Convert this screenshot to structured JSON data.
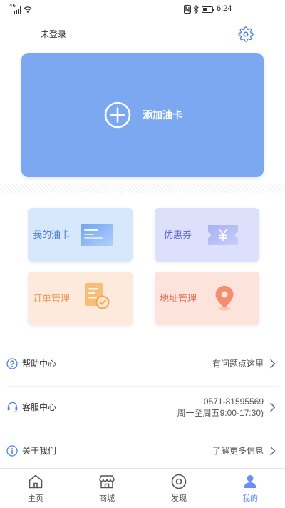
{
  "status_bar": {
    "network": "46",
    "time": "6:24",
    "icons": [
      "signal-icon",
      "wifi-icon",
      "nfc-icon",
      "bluetooth-icon",
      "battery-icon"
    ]
  },
  "header": {
    "login_status": "未登录",
    "settings_icon": "gear-icon"
  },
  "add_card": {
    "label": "添加油卡",
    "icon": "plus-circle-icon",
    "color": "#7BA8F1"
  },
  "features": [
    {
      "label": "我的油卡",
      "icon": "oil-card-icon",
      "bg": "#D7E7FC",
      "text_color": "#4A7CD3"
    },
    {
      "label": "优惠券",
      "icon": "coupon-icon",
      "bg": "#DDE0FB",
      "text_color": "#5F66D4"
    },
    {
      "label": "订单管理",
      "icon": "order-document-icon",
      "bg": "#FDEADD",
      "text_color": "#EE9B56"
    },
    {
      "label": "地址管理",
      "icon": "location-pin-icon",
      "bg": "#FCE4DD",
      "text_color": "#E57356"
    }
  ],
  "menu": [
    {
      "label": "帮助中心",
      "icon": "help-icon",
      "hint": "有问题点这里"
    },
    {
      "label": "客服中心",
      "icon": "headset-icon",
      "phone": "0571-81595569",
      "hours": "周一至周五9:00-17:30)"
    },
    {
      "label": "关于我们",
      "icon": "info-icon",
      "hint": "了解更多信息"
    }
  ],
  "tabs": [
    {
      "label": "主页",
      "icon": "home-icon",
      "active": false
    },
    {
      "label": "商城",
      "icon": "store-icon",
      "active": false
    },
    {
      "label": "发现",
      "icon": "discover-icon",
      "active": false
    },
    {
      "label": "我的",
      "icon": "profile-icon",
      "active": true
    }
  ],
  "colors": {
    "accent": "#5B8DEF",
    "icon_blue": "#4A80D9",
    "tab_inactive": "#555555",
    "text_primary": "#333333"
  }
}
